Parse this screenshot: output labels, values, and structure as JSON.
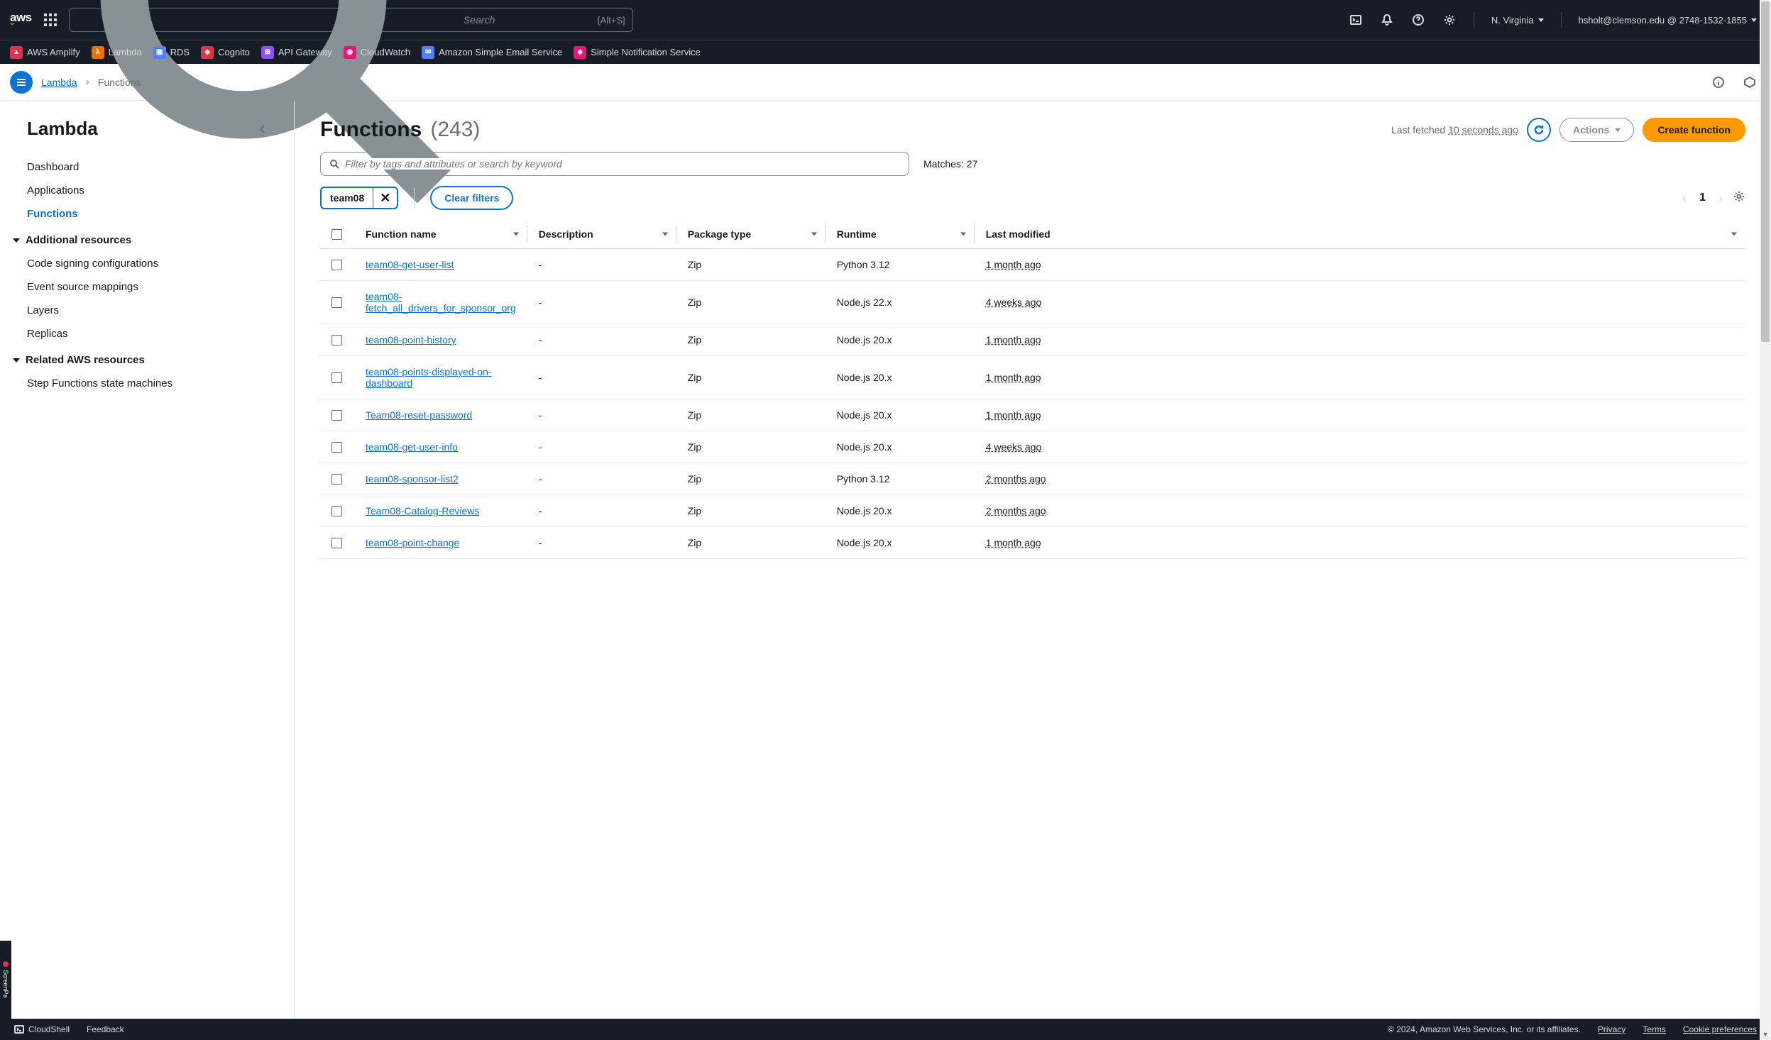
{
  "topbar": {
    "logo": "aws",
    "search_placeholder": "Search",
    "search_shortcut": "[Alt+S]",
    "region": "N. Virginia",
    "account": "hsholt@clemson.edu @ 2748-1532-1855"
  },
  "favorites": [
    {
      "label": "AWS Amplify",
      "icon": "amplify"
    },
    {
      "label": "Lambda",
      "icon": "lambda"
    },
    {
      "label": "RDS",
      "icon": "rds"
    },
    {
      "label": "Cognito",
      "icon": "cognito"
    },
    {
      "label": "API Gateway",
      "icon": "apigw"
    },
    {
      "label": "CloudWatch",
      "icon": "cw"
    },
    {
      "label": "Amazon Simple Email Service",
      "icon": "ses"
    },
    {
      "label": "Simple Notification Service",
      "icon": "sns"
    }
  ],
  "breadcrumb": {
    "service": "Lambda",
    "current": "Functions"
  },
  "sidebar": {
    "title": "Lambda",
    "nav": [
      {
        "label": "Dashboard",
        "active": false
      },
      {
        "label": "Applications",
        "active": false
      },
      {
        "label": "Functions",
        "active": true
      }
    ],
    "section1_title": "Additional resources",
    "section1_items": [
      "Code signing configurations",
      "Event source mappings",
      "Layers",
      "Replicas"
    ],
    "section2_title": "Related AWS resources",
    "section2_items": [
      "Step Functions state machines"
    ]
  },
  "page": {
    "title": "Functions",
    "count": "(243)",
    "last_fetched_prefix": "Last fetched ",
    "last_fetched_ago": "10 seconds ago",
    "actions_label": "Actions",
    "create_label": "Create function",
    "filter_placeholder": "Filter by tags and attributes or search by keyword",
    "matches": "Matches: 27",
    "chip": "team08",
    "clear_filters": "Clear filters",
    "page_current": "1"
  },
  "columns": {
    "name": "Function name",
    "desc": "Description",
    "pkg": "Package type",
    "runtime": "Runtime",
    "mod": "Last modified"
  },
  "rows": [
    {
      "name": "team08-get-user-list",
      "desc": "-",
      "pkg": "Zip",
      "runtime": "Python 3.12",
      "mod": "1 month ago"
    },
    {
      "name": "team08-fetch_all_drivers_for_sponsor_org",
      "desc": "-",
      "pkg": "Zip",
      "runtime": "Node.js 22.x",
      "mod": "4 weeks ago"
    },
    {
      "name": "team08-point-history",
      "desc": "-",
      "pkg": "Zip",
      "runtime": "Node.js 20.x",
      "mod": "1 month ago"
    },
    {
      "name": "team08-points-displayed-on-dashboard",
      "desc": "-",
      "pkg": "Zip",
      "runtime": "Node.js 20.x",
      "mod": "1 month ago"
    },
    {
      "name": "Team08-reset-password",
      "desc": "-",
      "pkg": "Zip",
      "runtime": "Node.js 20.x",
      "mod": "1 month ago"
    },
    {
      "name": "team08-get-user-info",
      "desc": "-",
      "pkg": "Zip",
      "runtime": "Node.js 20.x",
      "mod": "4 weeks ago"
    },
    {
      "name": "team08-sponsor-list2",
      "desc": "-",
      "pkg": "Zip",
      "runtime": "Python 3.12",
      "mod": "2 months ago"
    },
    {
      "name": "Team08-Catalog-Reviews",
      "desc": "-",
      "pkg": "Zip",
      "runtime": "Node.js 20.x",
      "mod": "2 months ago"
    },
    {
      "name": "team08-point-change",
      "desc": "-",
      "pkg": "Zip",
      "runtime": "Node.js 20.x",
      "mod": "1 month ago"
    }
  ],
  "footer": {
    "cloudshell": "CloudShell",
    "feedback": "Feedback",
    "copyright": "© 2024, Amazon Web Services, Inc. or its affiliates.",
    "privacy": "Privacy",
    "terms": "Terms",
    "cookies": "Cookie preferences"
  }
}
